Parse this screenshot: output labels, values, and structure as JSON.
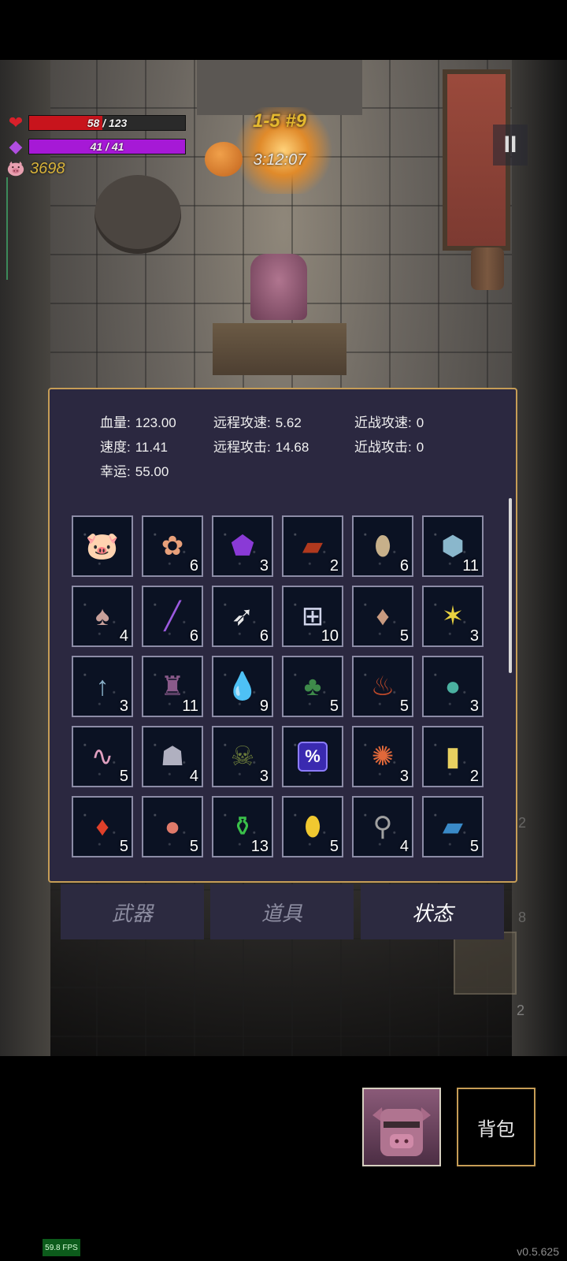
{
  "hud": {
    "hp_text": "58 / 123",
    "hp_fraction": 0.47,
    "mp_text": "41 / 41",
    "mp_fraction": 1.0,
    "gold": "3698",
    "level": "1-5 #9",
    "timer": "3:12:07",
    "pause_label": "II"
  },
  "colors": {
    "hp_bar": "#c8141c",
    "mp_bar": "#a619d6",
    "panel_border": "#c69d56",
    "panel_bg": "#2b2840"
  },
  "stats": {
    "row1": [
      {
        "label": "血量:",
        "value": "123.00"
      },
      {
        "label": "远程攻速:",
        "value": "5.62"
      },
      {
        "label": "近战攻速:",
        "value": "0"
      }
    ],
    "row2": [
      {
        "label": "速度:",
        "value": "11.41"
      },
      {
        "label": "远程攻击:",
        "value": "14.68"
      },
      {
        "label": "近战攻击:",
        "value": "0"
      }
    ],
    "row3": [
      {
        "label": "幸运:",
        "value": "55.00"
      }
    ]
  },
  "items": [
    {
      "icon": "piggy-bank-icon",
      "count": ""
    },
    {
      "icon": "flower-pair-icon",
      "count": "6"
    },
    {
      "icon": "purple-gem-icon",
      "count": "3"
    },
    {
      "icon": "red-book-icon",
      "count": "2"
    },
    {
      "icon": "egg-icon",
      "count": "6"
    },
    {
      "icon": "blue-stone-icon",
      "count": "11"
    },
    {
      "icon": "mushroom-icon",
      "count": "4"
    },
    {
      "icon": "purple-wand-icon",
      "count": "6"
    },
    {
      "icon": "feather-icon",
      "count": "6"
    },
    {
      "icon": "medkit-icon",
      "count": "10"
    },
    {
      "icon": "pouch-icon",
      "count": "5"
    },
    {
      "icon": "star-icon",
      "count": "3"
    },
    {
      "icon": "arrow-icon",
      "count": "3"
    },
    {
      "icon": "boots-icon",
      "count": "11"
    },
    {
      "icon": "water-drop-icon",
      "count": "9"
    },
    {
      "icon": "clover-icon",
      "count": "5"
    },
    {
      "icon": "fire-jar-icon",
      "count": "5"
    },
    {
      "icon": "rainbow-orb-icon",
      "count": "3"
    },
    {
      "icon": "worm-icon",
      "count": "5"
    },
    {
      "icon": "ghost-cloak-icon",
      "count": "4"
    },
    {
      "icon": "skull-book-icon",
      "count": "3"
    },
    {
      "icon": "percent-tile-icon",
      "count": ""
    },
    {
      "icon": "spiky-skull-icon",
      "count": "3"
    },
    {
      "icon": "yellow-card-icon",
      "count": "2"
    },
    {
      "icon": "red-crystal-icon",
      "count": "5"
    },
    {
      "icon": "apple-icon",
      "count": "5"
    },
    {
      "icon": "green-potion-icon",
      "count": "13"
    },
    {
      "icon": "yellow-crystal-icon",
      "count": "5"
    },
    {
      "icon": "vial-icon",
      "count": "4"
    },
    {
      "icon": "blue-book-icon",
      "count": "5"
    }
  ],
  "tabs": {
    "weapons": "武器",
    "items": "道具",
    "status": "状态"
  },
  "backpack_label": "背包",
  "fps": "59.8 FPS",
  "version": "v0.5.625",
  "side_numbers": [
    "2",
    "8",
    "2"
  ]
}
